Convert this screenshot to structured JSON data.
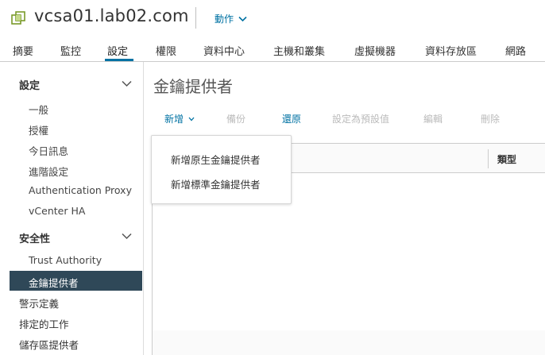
{
  "header": {
    "title": "vcsa01.lab02.com",
    "actions_label": "動作"
  },
  "tabs": [
    "摘要",
    "監控",
    "設定",
    "權限",
    "資料中心",
    "主機和叢集",
    "虛擬機器",
    "資料存放區",
    "網路"
  ],
  "active_tab": "設定",
  "sidebar": {
    "section_settings": "設定",
    "settings_items": [
      "一般",
      "授權",
      "今日訊息",
      "進階設定",
      "Authentication Proxy",
      "vCenter HA"
    ],
    "section_security": "安全性",
    "security_items": [
      "Trust Authority",
      "金鑰提供者"
    ],
    "root_items": [
      "警示定義",
      "排定的工作",
      "儲存區提供者"
    ]
  },
  "main": {
    "title": "金鑰提供者",
    "toolbar": {
      "add": "新增",
      "backup": "備份",
      "restore": "還原",
      "set_default": "設定為預設值",
      "edit": "編輯",
      "delete": "刪除"
    },
    "grid": {
      "col_type": "類型"
    },
    "add_menu": [
      "新增原生金鑰提供者",
      "新增標準金鑰提供者"
    ]
  },
  "colors": {
    "accent": "#0072a3",
    "selected_bg": "#2f4858",
    "disabled": "#bbbbbb"
  }
}
